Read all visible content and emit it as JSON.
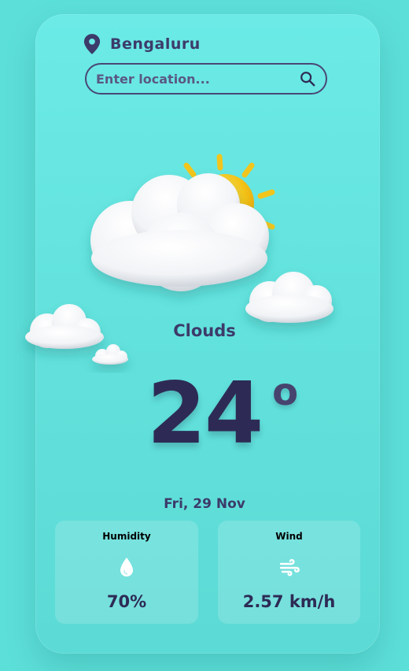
{
  "location": {
    "city": "Bengaluru",
    "icon": "map-pin-icon"
  },
  "search": {
    "placeholder": "Enter location...",
    "value": "",
    "icon": "search-icon"
  },
  "weather": {
    "condition": "Clouds",
    "temperature": "24",
    "degree_symbol": "o",
    "date": "Fri, 29 Nov",
    "illustration": "sun-behind-clouds-icon"
  },
  "stats": {
    "humidity": {
      "title": "Humidity",
      "value": "70%",
      "icon": "water-drop-icon"
    },
    "wind": {
      "title": "Wind",
      "value": "2.57 km/h",
      "icon": "wind-icon"
    }
  },
  "colors": {
    "background": "#5ddfd9",
    "card": "#6beae6",
    "text_primary": "#3c3b6a",
    "temperature": "#2d2b55",
    "sun": "#f5c518"
  }
}
